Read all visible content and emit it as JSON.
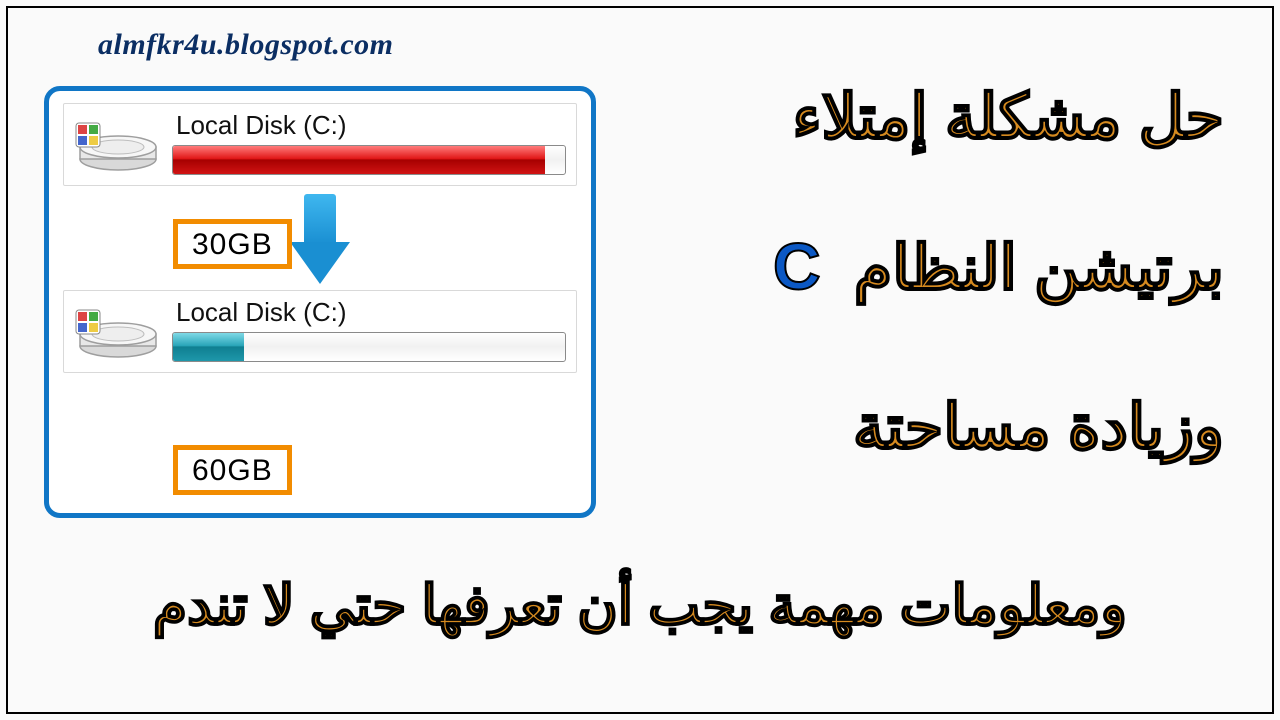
{
  "watermark": "almfkr4u.blogspot.com",
  "panel": {
    "disk_top": {
      "label": "Local Disk (C:)",
      "size_text": "30GB",
      "fill_percent": 95,
      "fill_color": "red"
    },
    "disk_bottom": {
      "label": "Local Disk (C:)",
      "size_text": "60GB",
      "fill_percent": 18,
      "fill_color": "teal"
    }
  },
  "headlines": {
    "line1": "حل مشكلة إمتلاء",
    "line2_rtl": "برتيشن النظام",
    "line2_letter": "C",
    "line3": "وزيادة مساحتة",
    "line4": "ومعلومات مهمة يجب أن تعرفها حتي لا تندم"
  },
  "colors": {
    "panel_border": "#1076c6",
    "accent_orange": "#f28c00",
    "headline_fill": "#d68a1f",
    "headline_stroke": "#000000",
    "letter_c": "#0b58c4"
  }
}
